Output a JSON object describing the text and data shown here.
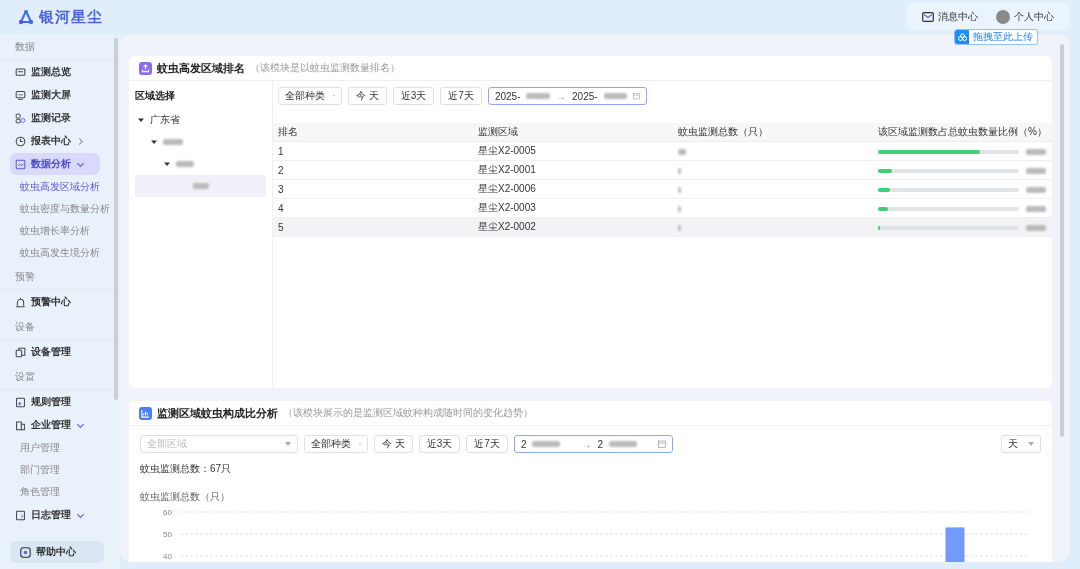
{
  "header": {
    "logo": "银河星尘",
    "messages": "消息中心",
    "profile": "个人中心",
    "upload_badge": "拖拽至此上传"
  },
  "sidebar": {
    "sections": [
      {
        "title": "数据",
        "items": [
          {
            "label": "监测总览",
            "selected": false
          },
          {
            "label": "监测大屏",
            "selected": false
          },
          {
            "label": "监测记录",
            "selected": false
          },
          {
            "label": "报表中心",
            "selected": false,
            "expanded": false
          },
          {
            "label": "数据分析",
            "selected": true,
            "expanded": true,
            "children": [
              {
                "label": "蚊虫高发区域分析",
                "selected": true
              },
              {
                "label": "蚊虫密度与数量分析",
                "selected": false
              },
              {
                "label": "蚊虫增长率分析",
                "selected": false
              },
              {
                "label": "蚊虫高发生境分析",
                "selected": false
              }
            ]
          }
        ]
      },
      {
        "title": "预警",
        "items": [
          {
            "label": "预警中心",
            "selected": false
          }
        ]
      },
      {
        "title": "设备",
        "items": [
          {
            "label": "设备管理",
            "selected": false
          }
        ]
      },
      {
        "title": "设置",
        "items": [
          {
            "label": "规则管理",
            "selected": false
          },
          {
            "label": "企业管理",
            "selected": false,
            "expanded": true,
            "children": [
              {
                "label": "用户管理",
                "selected": false
              },
              {
                "label": "部门管理",
                "selected": false
              },
              {
                "label": "角色管理",
                "selected": false
              }
            ]
          },
          {
            "label": "日志管理",
            "selected": false,
            "expanded": true
          }
        ]
      }
    ],
    "help": "帮助中心"
  },
  "ranking_card": {
    "title": "蚊虫高发区域排名",
    "note": "（该模块是以蚊虫监测数量排名）",
    "tree_title": "区域选择",
    "tree": [
      {
        "label": "广东省",
        "expanded": true,
        "selected": false,
        "children": [
          {
            "expanded": true,
            "selected": false,
            "children": [
              {
                "expanded": true,
                "selected": false,
                "children": [
                  {
                    "selected": true
                  }
                ]
              }
            ]
          }
        ]
      }
    ],
    "filters": {
      "species": "全部种类",
      "quick": [
        "今 天",
        "近3天",
        "近7天"
      ],
      "date_start": "2025-",
      "date_separator": "→",
      "date_end": "2025-"
    },
    "table": {
      "columns": [
        "排名",
        "监测区域",
        "蚊虫监测总数（只）",
        "该区域监测数占总蚊虫数量比例（%）"
      ],
      "rows": [
        {
          "rank": "1",
          "area": "星尘X2-0005",
          "level": 0.72,
          "selected": false
        },
        {
          "rank": "2",
          "area": "星尘X2-0001",
          "level": 0.1,
          "selected": false
        },
        {
          "rank": "3",
          "area": "星尘X2-0006",
          "level": 0.085,
          "selected": false
        },
        {
          "rank": "4",
          "area": "星尘X2-0003",
          "level": 0.07,
          "selected": false
        },
        {
          "rank": "5",
          "area": "星尘X2-0002",
          "level": 0.015,
          "selected": true
        }
      ]
    }
  },
  "composition_card": {
    "title": "监测区域蚊虫构成比分析",
    "note": "（该模块展示的是监测区域蚊种构成随时间的变化趋势）",
    "filters": {
      "region_placeholder": "全部区域",
      "species": "全部种类",
      "quick": [
        "今 天",
        "近3天",
        "近7天"
      ],
      "date_start": "2",
      "date_separator": "→",
      "date_end": "2",
      "granularity": "天"
    },
    "total": "蚊虫监测总数：67只",
    "chart_data": {
      "type": "bar",
      "ylabel": "蚊虫监测总数（只）",
      "ylim": [
        0,
        60
      ],
      "yticks": [
        40,
        50,
        60
      ],
      "series": [
        {
          "color": "#7399fb",
          "values": [
            null,
            null,
            null,
            null,
            null,
            null,
            null,
            null,
            null,
            null,
            null,
            null,
            null,
            null,
            null,
            53,
            null
          ]
        }
      ]
    }
  }
}
